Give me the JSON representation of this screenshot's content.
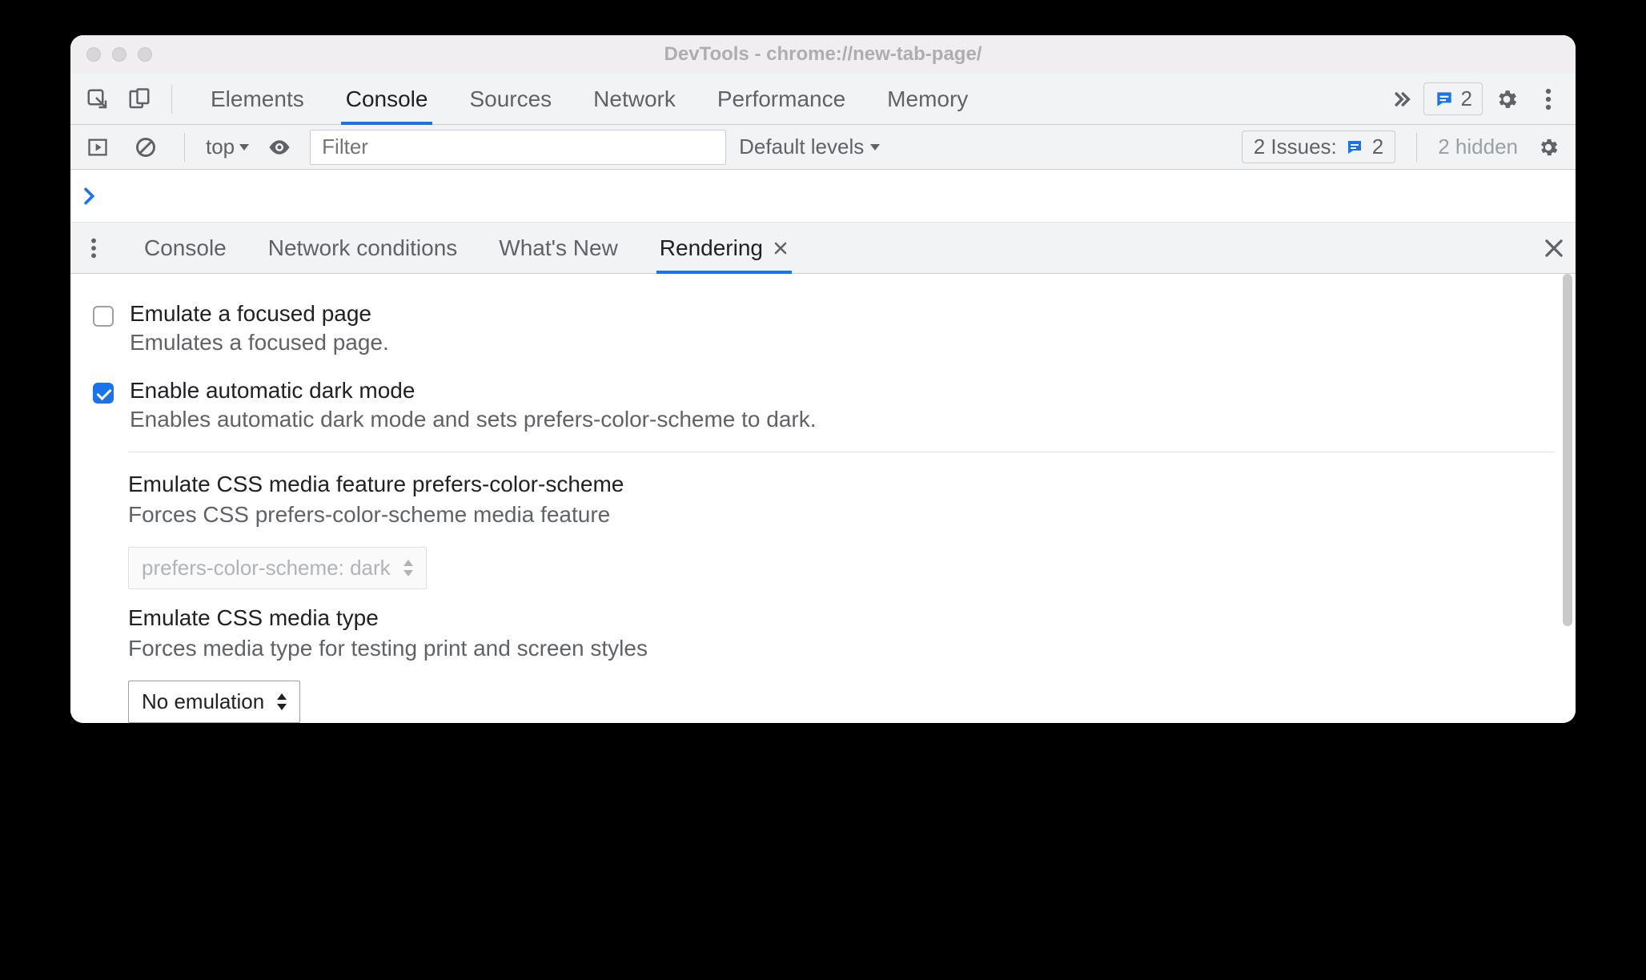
{
  "window_title": "DevTools - chrome://new-tab-page/",
  "main_tabs": [
    "Elements",
    "Console",
    "Sources",
    "Network",
    "Performance",
    "Memory"
  ],
  "main_active_tab": "Console",
  "badge_count": "2",
  "console_bar": {
    "context": "top",
    "filter_placeholder": "Filter",
    "levels": "Default levels",
    "issues_label": "2 Issues:",
    "issues_count": "2",
    "hidden": "2 hidden"
  },
  "drawer_tabs": [
    "Console",
    "Network conditions",
    "What's New",
    "Rendering"
  ],
  "drawer_active_tab": "Rendering",
  "rendering": {
    "focus_title": "Emulate a focused page",
    "focus_desc": "Emulates a focused page.",
    "darkmode_title": "Enable automatic dark mode",
    "darkmode_desc": "Enables automatic dark mode and sets prefers-color-scheme to dark.",
    "pcs_title": "Emulate CSS media feature prefers-color-scheme",
    "pcs_desc": "Forces CSS prefers-color-scheme media feature",
    "pcs_value": "prefers-color-scheme: dark",
    "media_title": "Emulate CSS media type",
    "media_desc": "Forces media type for testing print and screen styles",
    "media_value": "No emulation"
  }
}
